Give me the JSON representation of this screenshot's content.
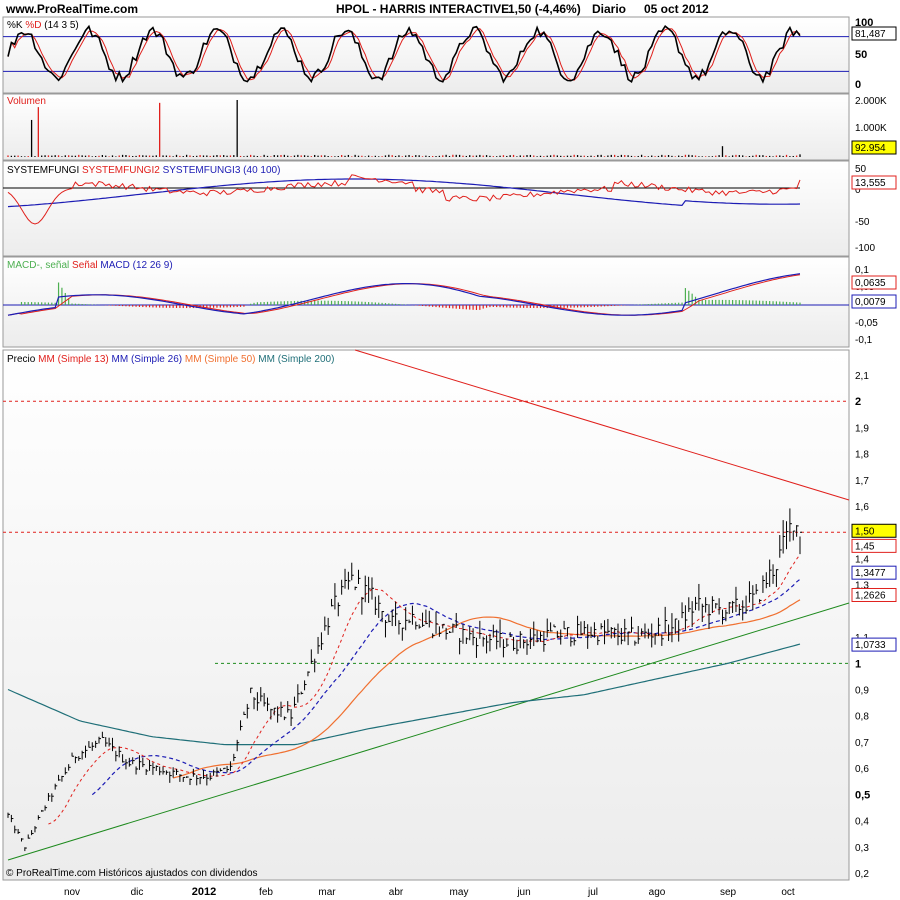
{
  "header": {
    "site": "www.ProRealTime.com",
    "title": "HPOL - HARRIS INTERACTIVE",
    "quote": "1,50 (-4,46%)",
    "period": "Diario",
    "date": "05 oct 2012"
  },
  "footer_note": "© ProRealTime.com  Históricos ajustados con dividendos",
  "months": [
    "nov",
    "dic",
    "2012",
    "feb",
    "mar",
    "abr",
    "may",
    "jun",
    "jul",
    "ago",
    "sep",
    "oct"
  ],
  "colors": {
    "black": "#000000",
    "red": "#e0201c",
    "blue": "#1c1cb4",
    "green": "#1e8a1e",
    "teal": "#1f6f78",
    "orange": "#f07030",
    "pink_fill": "#f0a0a8",
    "green_fill": "#a8e0a0",
    "highlight": "#ffff00"
  },
  "stoch": {
    "label": "%K %D (14 3 5)",
    "k_label": "%K",
    "d_label": "%D",
    "params": "(14 3 5)",
    "ticks": [
      "100",
      "50",
      "0"
    ],
    "value_badge": "81,487"
  },
  "volume": {
    "label": "Volumen",
    "ticks": [
      "2.000K",
      "1.000K"
    ],
    "value_badge": "92.954"
  },
  "systemfungi": {
    "label1": "SYSTEMFUNGI",
    "label2": "SYSTEMFUNGI2",
    "label3": "SYSTEMFUNGI3",
    "params": "(40 100)",
    "ticks": [
      "50",
      "0",
      "-50",
      "-100"
    ],
    "value_badge": "13,555"
  },
  "macd": {
    "label1": "MACD-, señal",
    "label2": "Señal",
    "label3": "MACD",
    "params": "(12 26 9)",
    "ticks": [
      "0,1",
      "0,05",
      "-0,05",
      "-0,1"
    ],
    "badge_signal": "0,0635",
    "badge_hist": "0,0079"
  },
  "price": {
    "label_precio": "Precio",
    "ma": [
      {
        "prefix": "MM",
        "name": "(Simple 13)",
        "color": "#e0201c"
      },
      {
        "prefix": "MM",
        "name": "(Simple 26)",
        "color": "#1c1cb4"
      },
      {
        "prefix": "MM",
        "name": "(Simple 50)",
        "color": "#f07030"
      },
      {
        "prefix": "MM",
        "name": "(Simple 200)",
        "color": "#1f6f78"
      }
    ],
    "ticks": [
      "2,1",
      "2",
      "1,9",
      "1,8",
      "1,7",
      "1,6",
      "1,50",
      "1,45",
      "1,4",
      "1,3477",
      "1,3",
      "1,2626",
      "1,1",
      "1,0733",
      "1",
      "0,9",
      "0,8",
      "0,7",
      "0,6",
      "0,5",
      "0,4",
      "0,3",
      "0,2"
    ],
    "badges": {
      "last": "1,50",
      "sma13": "1,45",
      "sma26": "1,3477",
      "sma50": "1,2626",
      "sma200": "1,0733"
    }
  },
  "chart_data": {
    "type": "line",
    "title": "HPOL - HARRIS INTERACTIVE",
    "xlabel": "",
    "ylabel": "",
    "x": [
      "nov",
      "dic",
      "2012",
      "feb",
      "mar",
      "abr",
      "may",
      "jun",
      "jul",
      "ago",
      "sep",
      "oct"
    ],
    "ylim": [
      0.2,
      2.15
    ],
    "last_close": 1.5,
    "change_pct": -4.46,
    "series": [
      {
        "name": "Precio",
        "values": [
          0.45,
          0.62,
          0.58,
          0.78,
          0.95,
          1.27,
          1.13,
          1.08,
          1.11,
          1.12,
          1.23,
          1.5
        ]
      },
      {
        "name": "MM (Simple 13)",
        "values": [
          0.47,
          0.59,
          0.6,
          0.7,
          0.9,
          1.2,
          1.15,
          1.1,
          1.1,
          1.11,
          1.2,
          1.45
        ]
      },
      {
        "name": "MM (Simple 26)",
        "values": [
          0.45,
          0.58,
          0.59,
          0.65,
          0.85,
          1.15,
          1.15,
          1.1,
          1.1,
          1.1,
          1.17,
          1.3477
        ]
      },
      {
        "name": "MM (Simple 50)",
        "values": [
          0.55,
          0.58,
          0.6,
          0.63,
          0.72,
          0.98,
          1.12,
          1.12,
          1.11,
          1.1,
          1.14,
          1.2626
        ]
      },
      {
        "name": "MM (Simple 200)",
        "values": [
          0.9,
          0.78,
          0.72,
          0.69,
          0.69,
          0.75,
          0.8,
          0.85,
          0.88,
          0.94,
          1.0,
          1.0733
        ]
      }
    ],
    "support_lines": [
      1.5,
      2.0,
      1.0
    ],
    "indicators": {
      "stoch_k_last": 81.487,
      "volume_last": 92954,
      "systemfungi_last": 13.555,
      "macd_signal_last": 0.0635,
      "macd_hist_last": 0.0079
    },
    "grid": false,
    "legend": "top-left"
  }
}
